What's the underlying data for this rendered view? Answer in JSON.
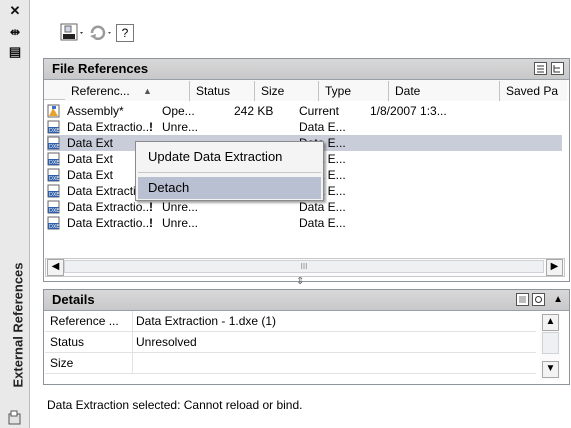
{
  "palette": {
    "header_bg": "#cfcfd0",
    "selection": "#c8cdd9",
    "menu_highlight": "#b9c0d2",
    "warning": "#000000"
  },
  "dock": {
    "title": "External References",
    "close_glyph": "✕",
    "pin_glyph": "⇹",
    "menu_glyph": "▤"
  },
  "toolbar": {
    "attach_icon": "attach-dwg-icon",
    "refresh_icon": "refresh-icon",
    "help_glyph": "?"
  },
  "file_refs": {
    "title": "File References",
    "columns": [
      "Referenc...",
      "Status",
      "Size",
      "Type",
      "Date",
      "Saved Pa"
    ],
    "sort_glyph": "▲",
    "rows": [
      {
        "name": "Assembly*",
        "flag": "",
        "status": "Ope...",
        "size": "242 KB",
        "type": "Current",
        "date": "1/8/2007 1:3...",
        "icon": "dwg"
      },
      {
        "name": "Data Extractio...",
        "flag": "!",
        "status": "Unre...",
        "size": "",
        "type": "Data E...",
        "date": "",
        "icon": "dxe"
      },
      {
        "name": "Data Ext",
        "flag": "",
        "status": "",
        "size": "",
        "type": "Data E...",
        "date": "",
        "icon": "dxe"
      },
      {
        "name": "Data Ext",
        "flag": "",
        "status": "",
        "size": "",
        "type": "Data E...",
        "date": "",
        "icon": "dxe"
      },
      {
        "name": "Data Ext",
        "flag": "",
        "status": "",
        "size": "",
        "type": "Data E...",
        "date": "",
        "icon": "dxe"
      },
      {
        "name": "Data Extractio...",
        "flag": "!",
        "status": "Unre...",
        "size": "",
        "type": "Data E...",
        "date": "",
        "icon": "dxe"
      },
      {
        "name": "Data Extractio...",
        "flag": "!",
        "status": "Unre...",
        "size": "",
        "type": "Data E...",
        "date": "",
        "icon": "dxe"
      },
      {
        "name": "Data Extractio...",
        "flag": "!",
        "status": "Unre...",
        "size": "",
        "type": "Data E...",
        "date": "",
        "icon": "dxe"
      }
    ],
    "scroll_mid": "III",
    "splitter_glyph": "⇕"
  },
  "context_menu": {
    "items": [
      "Update Data Extraction",
      "Detach"
    ]
  },
  "details": {
    "title": "Details",
    "rows": [
      {
        "key": "Reference ...",
        "value": "Data Extraction - 1.dxe (1)"
      },
      {
        "key": "Status",
        "value": "Unresolved"
      },
      {
        "key": "Size",
        "value": ""
      }
    ]
  },
  "status_message": "Data Extraction selected:  Cannot reload or bind."
}
